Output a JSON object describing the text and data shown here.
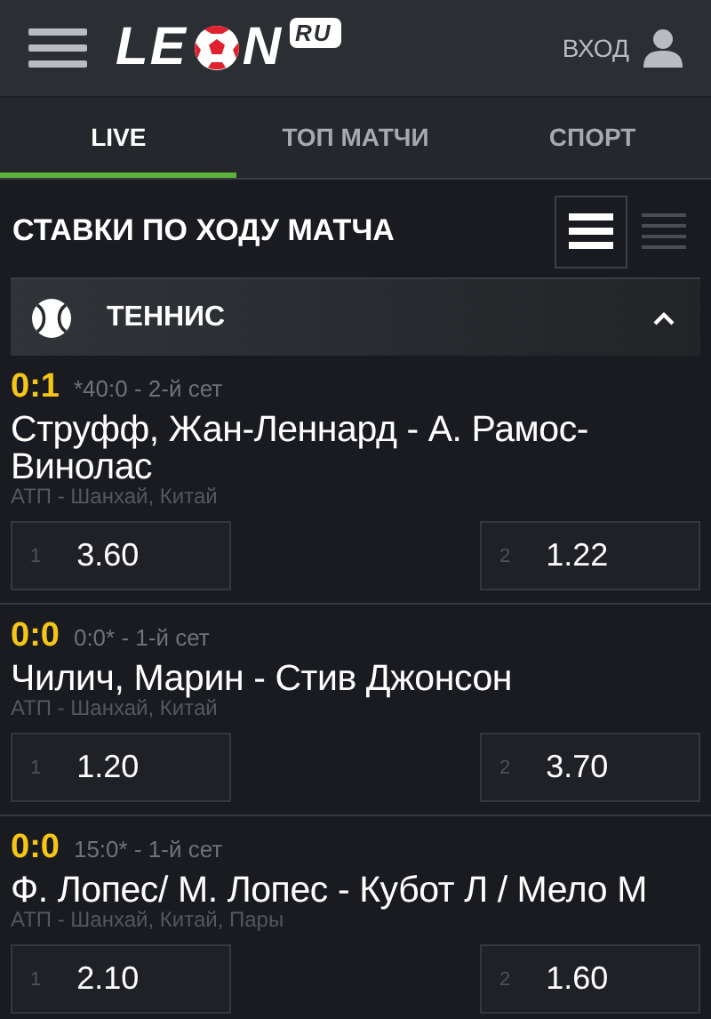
{
  "header": {
    "logo": {
      "before_ball": "LE",
      "after_ball": "N",
      "badge": "RU"
    },
    "login": "ВХОД"
  },
  "tabs": [
    {
      "label": "LIVE",
      "selected": true
    },
    {
      "label": "ТОП МАТЧИ",
      "selected": false
    },
    {
      "label": "СПОРТ",
      "selected": false
    }
  ],
  "section_title": "СТАВКИ ПО ХОДУ МАТЧА",
  "view_modes": [
    {
      "kind": "wide",
      "selected": true
    },
    {
      "kind": "compact",
      "selected": false
    }
  ],
  "sport": {
    "name": "ТЕННИС",
    "expanded": true
  },
  "matches": [
    {
      "score": "0:1",
      "status": "*40:0 - 2-й сет",
      "teams": "Струфф, Жан-Леннард - А. Рамос-Винолас",
      "league": "АТП - Шанхай, Китай",
      "odds": [
        {
          "label": "1",
          "value": "3.60"
        },
        {
          "label": "2",
          "value": "1.22"
        }
      ]
    },
    {
      "score": "0:0",
      "status": "0:0* - 1-й сет",
      "teams": "Чилич, Марин - Стив Джонсон",
      "league": "АТП - Шанхай, Китай",
      "odds": [
        {
          "label": "1",
          "value": "1.20"
        },
        {
          "label": "2",
          "value": "3.70"
        }
      ]
    },
    {
      "score": "0:0",
      "status": "15:0* - 1-й сет",
      "teams": "Ф. Лопес/ М. Лопес - Кубот Л / Мело М",
      "league": "АТП - Шанхай, Китай, Пары",
      "odds": [
        {
          "label": "1",
          "value": "2.10"
        },
        {
          "label": "2",
          "value": "1.60"
        }
      ]
    }
  ]
}
